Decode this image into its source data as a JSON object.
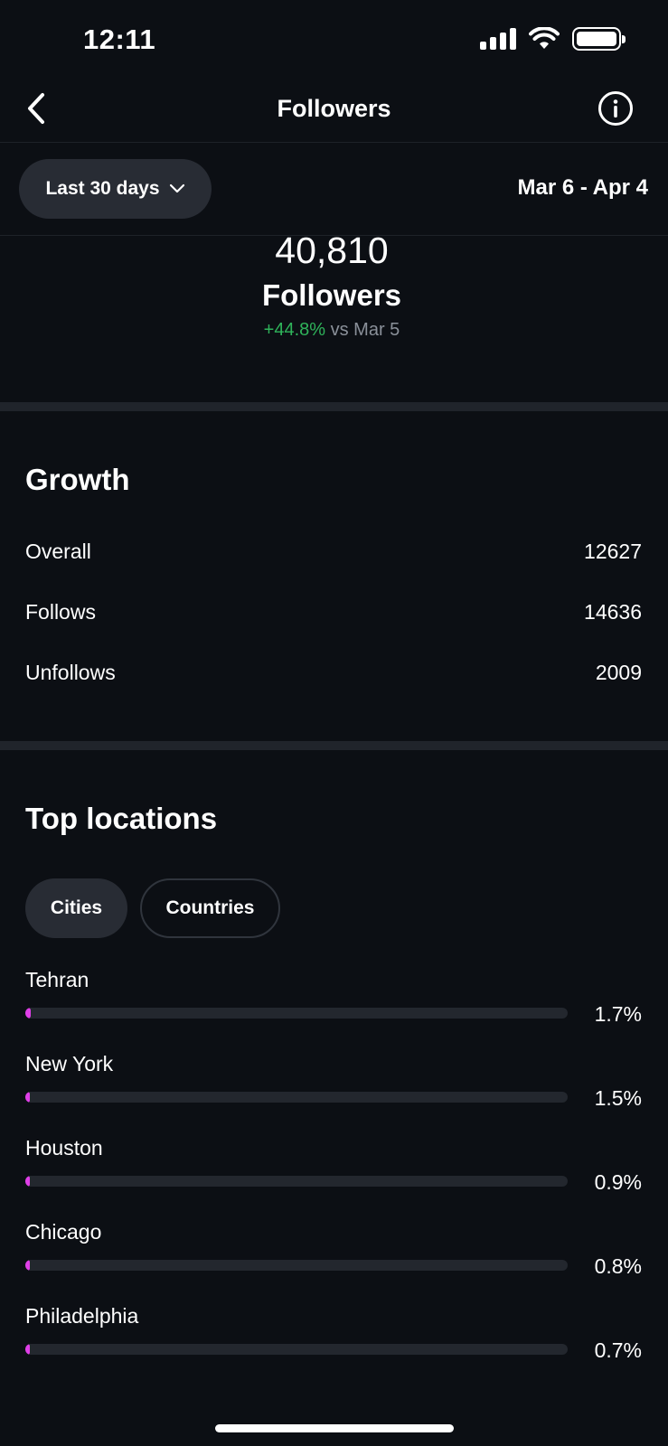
{
  "status_bar": {
    "time": "12:11"
  },
  "nav": {
    "title": "Followers"
  },
  "filter": {
    "range_label": "Last 30 days",
    "date_range": "Mar 6 - Apr 4"
  },
  "summary": {
    "count": "40,810",
    "label": "Followers",
    "change": "+44.8%",
    "comparison": "vs Mar 5"
  },
  "growth": {
    "title": "Growth",
    "rows": [
      {
        "label": "Overall",
        "value": "12627"
      },
      {
        "label": "Follows",
        "value": "14636"
      },
      {
        "label": "Unfollows",
        "value": "2009"
      }
    ]
  },
  "locations": {
    "title": "Top locations",
    "tabs": [
      "Cities",
      "Countries"
    ],
    "selected_tab": "Cities",
    "items": [
      {
        "name": "Tehran",
        "percent": "1.7%",
        "fraction": 0.017
      },
      {
        "name": "New York",
        "percent": "1.5%",
        "fraction": 0.015
      },
      {
        "name": "Houston",
        "percent": "0.9%",
        "fraction": 0.009
      },
      {
        "name": "Chicago",
        "percent": "0.8%",
        "fraction": 0.008
      },
      {
        "name": "Philadelphia",
        "percent": "0.7%",
        "fraction": 0.007
      }
    ]
  },
  "colors": {
    "accent_bar": "#e03fe8",
    "positive": "#2fb35a",
    "background": "#0c0f14"
  }
}
